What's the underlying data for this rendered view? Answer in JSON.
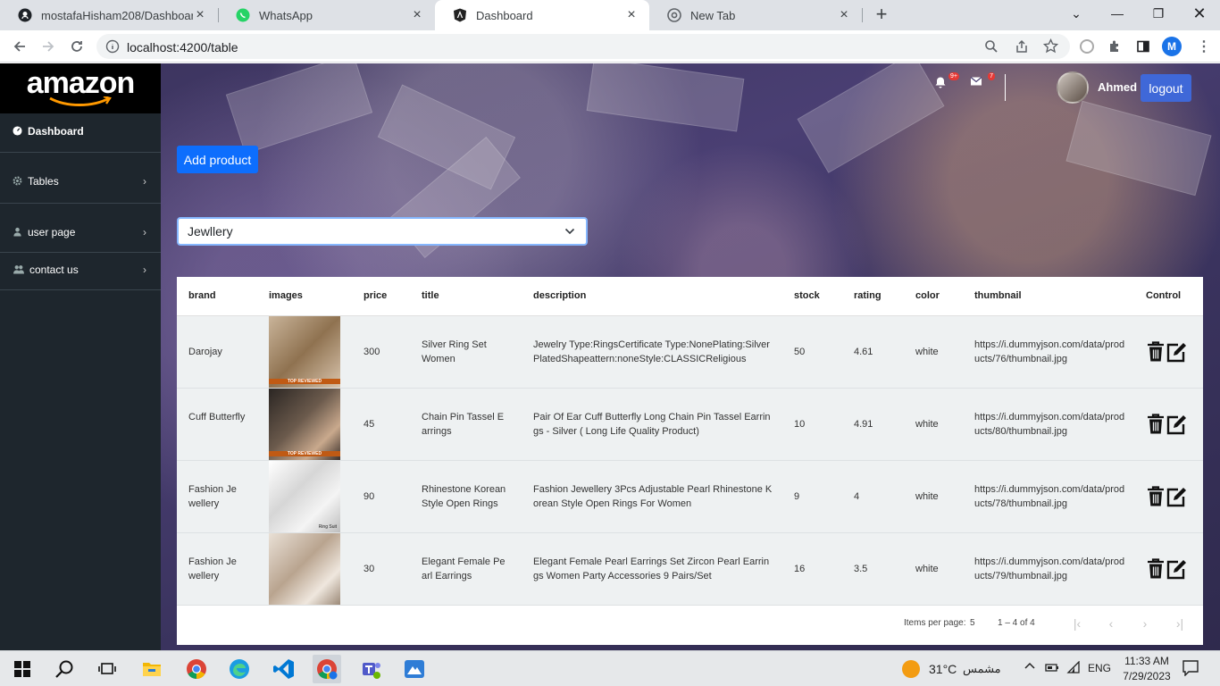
{
  "browser": {
    "tabs": [
      {
        "title": "mostafaHisham208/Dashboard_A",
        "icon": "github-icon"
      },
      {
        "title": "WhatsApp",
        "icon": "whatsapp-icon"
      },
      {
        "title": "Dashboard",
        "icon": "angular-icon",
        "active": true
      },
      {
        "title": "New Tab",
        "icon": "chrome-icon"
      }
    ],
    "url": "localhost:4200/table",
    "profile_initial": "M"
  },
  "sidebar": {
    "logo": "amazon",
    "items": [
      {
        "label": "Dashboard",
        "icon": "dashboard-icon"
      },
      {
        "label": "Tables",
        "icon": "gear-icon"
      },
      {
        "label": "user page",
        "icon": "user-icon"
      },
      {
        "label": "contact us",
        "icon": "users-icon"
      }
    ]
  },
  "header": {
    "notifications_badge": "9+",
    "messages_badge": "7",
    "user_name": "Ahmed",
    "logout_label": "logout"
  },
  "main": {
    "add_product_label": "Add product",
    "category_selected": "Jewllery"
  },
  "table": {
    "columns": [
      "brand",
      "images",
      "price",
      "title",
      "description",
      "stock",
      "rating",
      "color",
      "thumbnail",
      "Control"
    ],
    "rows": [
      {
        "brand": "Darojay",
        "price": "300",
        "title": "Silver Ring Set Women",
        "description": "Jewelry Type:RingsCertificate Type:NonePlating:Silver PlatedShapeattern:noneStyle:CLASSICReligious",
        "stock": "50",
        "rating": "4.61",
        "color": "white",
        "thumbnail": "https://i.dummyjson.com/data/products/76/thumbnail.jpg",
        "image_caption": "TOP REVIEWED"
      },
      {
        "brand": "Cuff Butterfly",
        "price": "45",
        "title": "Chain Pin Tassel Earrings",
        "description": "Pair Of Ear Cuff Butterfly Long Chain Pin Tassel Earrings - Silver ( Long Life Quality Product)",
        "stock": "10",
        "rating": "4.91",
        "color": "white",
        "thumbnail": "https://i.dummyjson.com/data/products/80/thumbnail.jpg",
        "image_caption": "TOP REVIEWED"
      },
      {
        "brand": "Fashion Jewellery",
        "price": "90",
        "title": "Rhinestone Korean Style Open Rings",
        "description": "Fashion Jewellery 3Pcs Adjustable Pearl Rhinestone Korean Style Open Rings For Women",
        "stock": "9",
        "rating": "4",
        "color": "white",
        "thumbnail": "https://i.dummyjson.com/data/products/78/thumbnail.jpg",
        "image_caption": "Ring Suit"
      },
      {
        "brand": "Fashion Jewellery",
        "price": "30",
        "title": "Elegant Female Pearl Earrings",
        "description": "Elegant Female Pearl Earrings Set Zircon Pearl Earrings Women Party Accessories 9 Pairs/Set",
        "stock": "16",
        "rating": "3.5",
        "color": "white",
        "thumbnail": "https://i.dummyjson.com/data/products/79/thumbnail.jpg",
        "image_caption": ""
      }
    ]
  },
  "pager": {
    "items_per_page_label": "Items per page:",
    "items_per_page": "5",
    "range": "1 – 4 of 4"
  },
  "taskbar": {
    "weather": "31°C",
    "weather_text": "مشمس",
    "language": "ENG",
    "time": "11:33 AM",
    "date": "7/29/2023"
  }
}
